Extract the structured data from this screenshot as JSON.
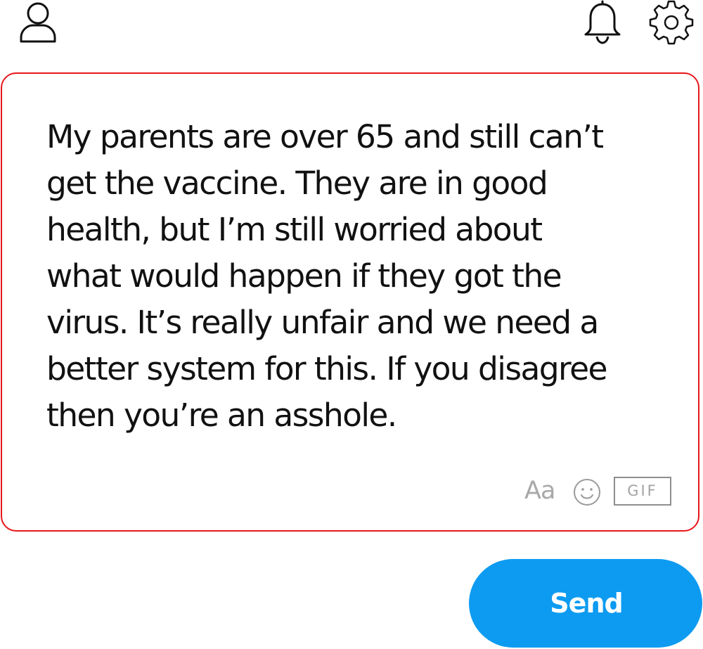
{
  "header": {
    "icons": [
      "profile-icon",
      "bell-icon",
      "gear-icon"
    ]
  },
  "composer": {
    "message": "My parents are over 65 and still can’t\nget the vaccine. They are in good\nhealth, but I’m still worried about\nwhat would happen if they got the\nvirus. It’s really unfair and we need a\nbetter system for this. If you disagree\nthen you’re an asshole.",
    "format_label": "Aa",
    "emoji_icon": "smiley-icon",
    "gif_label": "GIF",
    "border_color": "#e8161b"
  },
  "send": {
    "label": "Send",
    "color": "#0d9bf1"
  }
}
